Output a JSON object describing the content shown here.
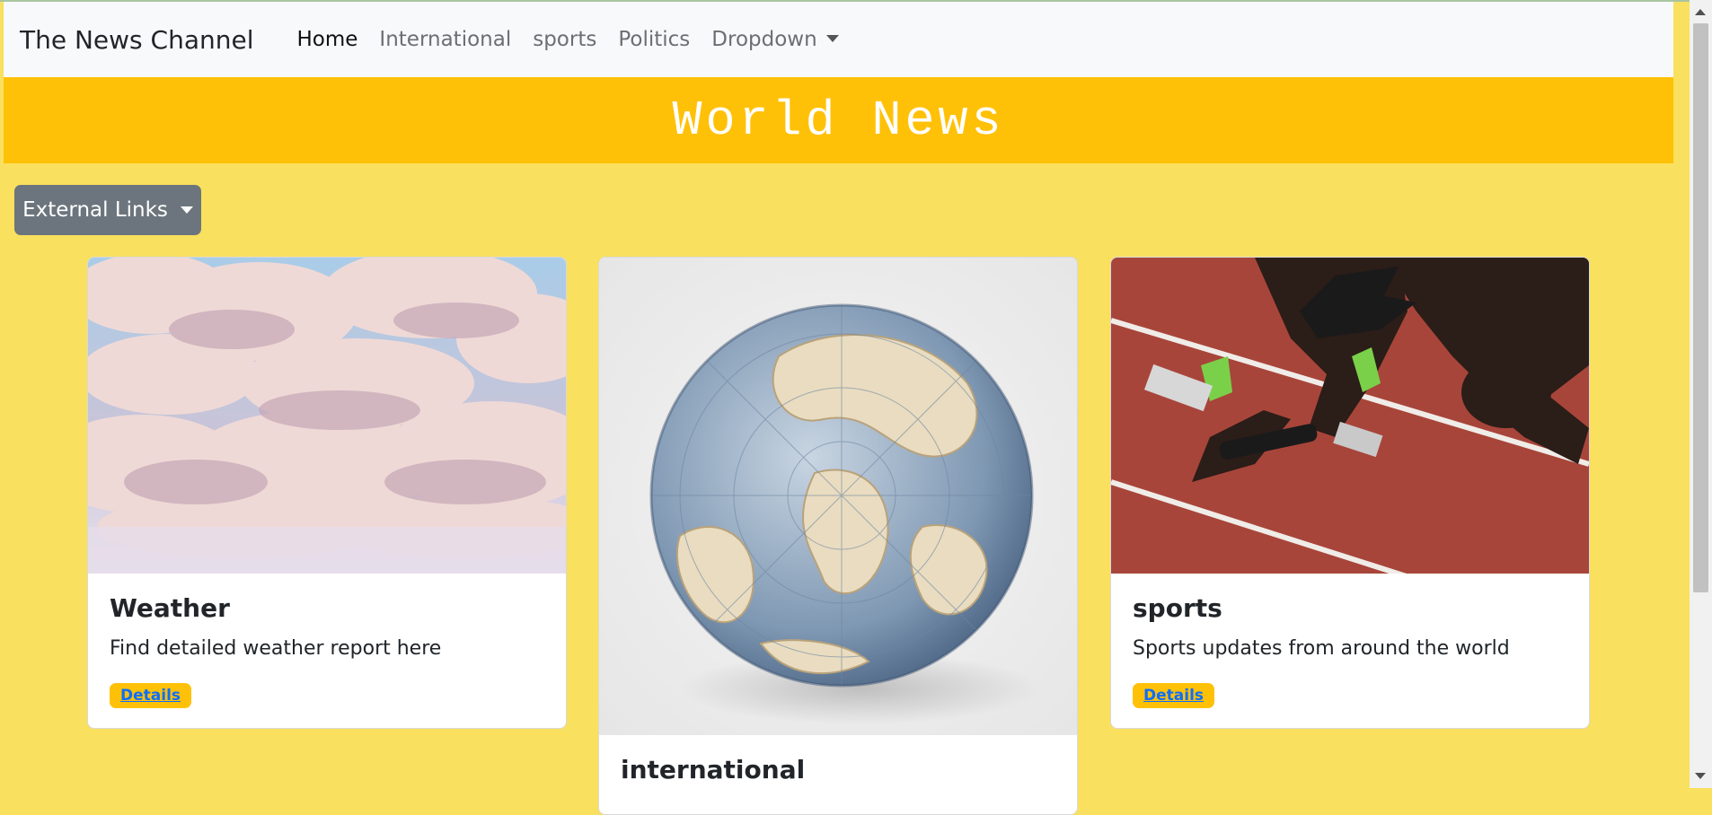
{
  "navbar": {
    "brand": "The News Channel",
    "links": [
      {
        "label": "Home",
        "active": true
      },
      {
        "label": "International"
      },
      {
        "label": "sports"
      },
      {
        "label": "Politics"
      },
      {
        "label": "Dropdown"
      }
    ]
  },
  "banner": {
    "title": "World News"
  },
  "external_links": {
    "label": "External Links"
  },
  "cards": [
    {
      "image": "clouds-sky-image",
      "title": "Weather",
      "text": "Find detailed weather report here",
      "button": "Details"
    },
    {
      "image": "globe-image",
      "title": "international"
    },
    {
      "image": "runner-track-image",
      "title": "sports",
      "text": "Sports updates from around the world",
      "button": "Details"
    }
  ],
  "colors": {
    "page_bg": "#f9e05e",
    "banner_bg": "#ffc107",
    "navbar_bg": "#f8f9fa",
    "button_secondary": "#6c757d",
    "link_blue": "#0d6efd"
  }
}
